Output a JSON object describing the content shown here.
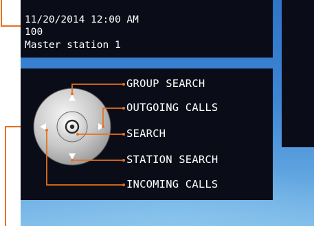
{
  "info": {
    "datetime": "11/20/2014 12:00 AM",
    "number": "100",
    "station": "Master station 1"
  },
  "nav": {
    "group_search": "GROUP SEARCH",
    "outgoing_calls": "OUTGOING CALLS",
    "search": "SEARCH",
    "station_search": "STATION SEARCH",
    "incoming_calls": "INCOMING CALLS"
  },
  "colors": {
    "callout": "#e8701c",
    "panel": "#0a0d18",
    "screen_blue": "#3f86d4"
  },
  "icons": {
    "center": "select-button-icon",
    "up": "arrow-up-icon",
    "down": "arrow-down-icon",
    "left": "arrow-left-icon",
    "right": "arrow-right-icon"
  }
}
